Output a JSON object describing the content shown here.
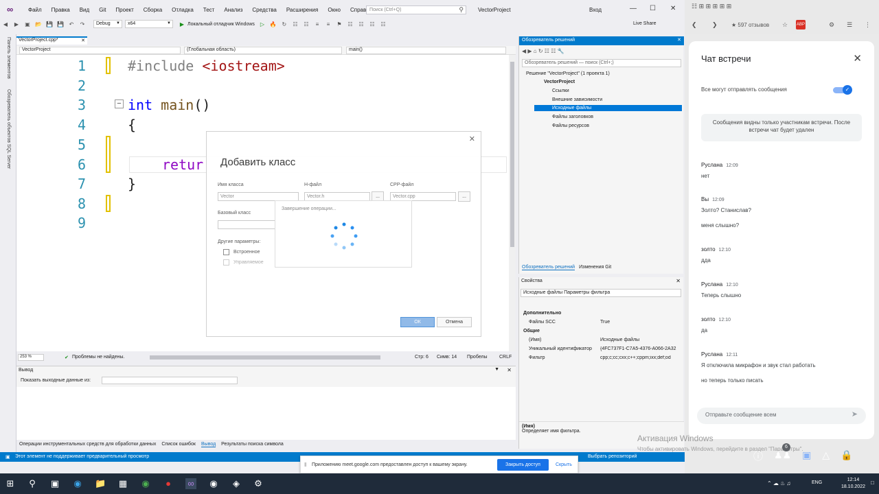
{
  "vs": {
    "menu": [
      "Файл",
      "Правка",
      "Вид",
      "Git",
      "Проект",
      "Сборка",
      "Отладка",
      "Тест",
      "Анализ",
      "Средства",
      "Расширения",
      "Окно",
      "Справка"
    ],
    "search_placeholder": "Поиск (Ctrl+Q)",
    "project_title": "VectorProject",
    "login": "Вход",
    "config": "Debug",
    "platform": "x64",
    "debugger": "Локальный отладчик Windows",
    "live_share": "Live Share",
    "doc_tab": "VectorProject.cpp*",
    "nav": {
      "project": "VectorProject",
      "scope": "(Глобальная область)",
      "member": "main()"
    },
    "left_strip": [
      "Панель элементов",
      "Обозреватель объектов SQL Server"
    ],
    "code_lines": [
      "1",
      "2",
      "3",
      "4",
      "5",
      "6",
      "7",
      "8",
      "9"
    ],
    "code": {
      "l1_pp": "#include",
      "l1_inc": "<iostream>",
      "l3_kw": "int",
      "l3_fn": "main",
      "l3_rest": "()",
      "l4": "{",
      "l6": "retur",
      "l7": "}"
    },
    "status_edit": {
      "zoom": "253 %",
      "problems": "Проблемы не найдены.",
      "line": "Стр: 6",
      "col": "Симв: 14",
      "ws": "Пробелы",
      "eol": "CRLF"
    },
    "output": {
      "title": "Вывод",
      "show_label": "Показать выходные данные из:"
    },
    "bottom_tabs": [
      "Операции инструментальных средств для обработки данных",
      "Список ошибок",
      "Вывод",
      "Результаты поиска символа"
    ],
    "statusbar": {
      "left": "Этот элемент не поддерживает предварительный просмотр",
      "repo": "Выбрать репозиторий"
    }
  },
  "solution": {
    "title": "Обозреватель решений",
    "search_placeholder": "Обозреватель решений — поиск (Ctrl+;)",
    "items": [
      "Решение \"VectorProject\" (1 проекта 1)",
      "VectorProject",
      "Ссылки",
      "Внешние зависимости",
      "Исходные файлы",
      "Файлы заголовков",
      "Файлы ресурсов"
    ],
    "tabs": [
      "Обозреватель решений",
      "Изменения Git"
    ]
  },
  "props": {
    "title": "Свойства",
    "combo": "Исходные файлы  Параметры фильтра",
    "sections": [
      "Дополнительно",
      "Общие"
    ],
    "rows": [
      {
        "k": "Файлы SCC",
        "v": "True"
      },
      {
        "k": "(Имя)",
        "v": "Исходные файлы"
      },
      {
        "k": "Уникальный идентификатор",
        "v": "{4FC737F1-C7A5-4376-A066-2A32"
      },
      {
        "k": "Фильтр",
        "v": "cpp;c;cc;cxx;c++;cppm;ixx;def;od"
      }
    ],
    "desc_title": "(Имя)",
    "desc_text": "Определяет имя фильтра."
  },
  "dialog": {
    "title": "Добавить класс",
    "class_name_label": "Имя класса",
    "class_name_value": "Vector",
    "h_label": "H-файл",
    "h_value": "Vector.h",
    "cpp_label": "CPP-файл",
    "cpp_value": "Vector.cpp",
    "base_label": "Базовый класс",
    "other_label": "Другие параметры:",
    "inline_label": "Встроенное",
    "managed_label": "Управляемое",
    "ok": "ОК",
    "cancel": "Отмена",
    "busy_text": "Завершение операции...",
    "dots": "..."
  },
  "chat": {
    "title": "Чат встречи",
    "toggle_label": "Все могут отправлять сообщения",
    "notice": "Сообщения видны только участникам встречи. После встречи чат будет удален",
    "messages": [
      {
        "author": "Руслана",
        "time": "12:09",
        "lines": [
          "нет"
        ]
      },
      {
        "author": "Вы",
        "time": "12:09",
        "lines": [
          "Золто? Станислав?",
          "меня слышно?"
        ]
      },
      {
        "author": "золто",
        "time": "12:10",
        "lines": [
          "дда"
        ]
      },
      {
        "author": "Руслана",
        "time": "12:10",
        "lines": [
          "Теперь слышно"
        ]
      },
      {
        "author": "золто",
        "time": "12:10",
        "lines": [
          "да"
        ]
      },
      {
        "author": "Руслана",
        "time": "12:11",
        "lines": [
          "Я отключила микрафон и звук стал работать",
          "но теперь только писать"
        ]
      }
    ],
    "input_placeholder": "Отправьте сообщение всем",
    "browser_ext_text": "★ 597 отзывов"
  },
  "activation": {
    "title": "Активация Windows",
    "sub": "Чтобы активировать Windows, перейдите в раздел \"Параметры\"."
  },
  "sharebar": {
    "text": "Приложению meet.google.com предоставлен доступ к вашему экрану.",
    "stop": "Закрыть доступ",
    "hide": "Скрыть"
  },
  "taskbar": {
    "lang": "ENG",
    "time": "12:14",
    "date": "18.10.2022",
    "badge": "6"
  },
  "colors": {
    "accent": "#007acc",
    "selection": "#0078d7",
    "meet_blue": "#1a73e8"
  }
}
